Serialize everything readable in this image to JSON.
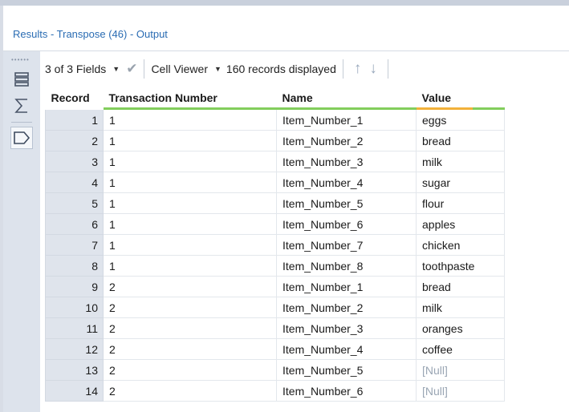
{
  "panel": {
    "title": "Results - Transpose (46) - Output"
  },
  "toolbar": {
    "fields_label": "3 of 3 Fields",
    "cell_viewer_label": "Cell Viewer",
    "records_label": "160 records displayed"
  },
  "icons": {
    "grip": "grip-dots-icon",
    "table_view": "table-view-icon",
    "summary": "sigma-icon",
    "tag": "tag-icon",
    "check": "checkmark-icon",
    "up": "arrow-up-icon",
    "down": "arrow-down-icon"
  },
  "colors": {
    "title_blue": "#2a6cb3",
    "header_green": "#82ce5c",
    "header_orange": "#f2b13a",
    "record_gray": "#dfe4ec",
    "null_gray": "#9aa6b4"
  },
  "grid": {
    "columns": [
      "Record",
      "Transaction Number",
      "Name",
      "Value"
    ],
    "rows": [
      {
        "record": "1",
        "transaction": "1",
        "name": "Item_Number_1",
        "value": "eggs"
      },
      {
        "record": "2",
        "transaction": "1",
        "name": "Item_Number_2",
        "value": "bread"
      },
      {
        "record": "3",
        "transaction": "1",
        "name": "Item_Number_3",
        "value": "milk"
      },
      {
        "record": "4",
        "transaction": "1",
        "name": "Item_Number_4",
        "value": "sugar"
      },
      {
        "record": "5",
        "transaction": "1",
        "name": "Item_Number_5",
        "value": "flour"
      },
      {
        "record": "6",
        "transaction": "1",
        "name": "Item_Number_6",
        "value": "apples"
      },
      {
        "record": "7",
        "transaction": "1",
        "name": "Item_Number_7",
        "value": "chicken"
      },
      {
        "record": "8",
        "transaction": "1",
        "name": "Item_Number_8",
        "value": "toothpaste"
      },
      {
        "record": "9",
        "transaction": "2",
        "name": "Item_Number_1",
        "value": "bread"
      },
      {
        "record": "10",
        "transaction": "2",
        "name": "Item_Number_2",
        "value": "milk"
      },
      {
        "record": "11",
        "transaction": "2",
        "name": "Item_Number_3",
        "value": "oranges"
      },
      {
        "record": "12",
        "transaction": "2",
        "name": "Item_Number_4",
        "value": "coffee"
      },
      {
        "record": "13",
        "transaction": "2",
        "name": "Item_Number_5",
        "value": "[Null]"
      },
      {
        "record": "14",
        "transaction": "2",
        "name": "Item_Number_6",
        "value": "[Null]"
      }
    ]
  }
}
